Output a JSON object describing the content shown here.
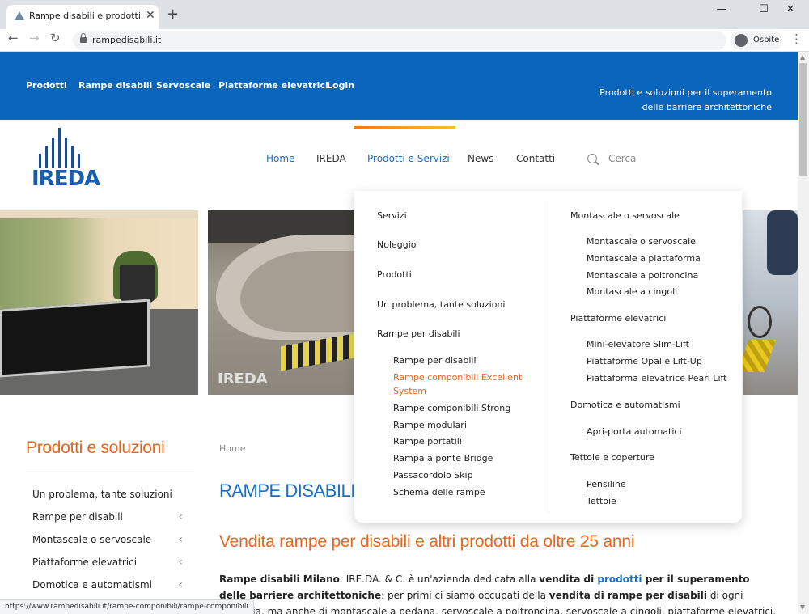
{
  "browser": {
    "tab_title": "Rampe disabili e prodotti per sup",
    "new_tab": "+",
    "close_tab": "✕",
    "url": "rampedisabili.it",
    "profile_label": "Ospite",
    "window_min": "—",
    "window_max": "☐",
    "window_close": "✕"
  },
  "topbar": {
    "links": [
      "Prodotti",
      "Rampe disabili",
      "Servoscale",
      "Piattaforme elevatrici",
      "Login"
    ],
    "tagline_line1": "Prodotti e soluzioni per il superamento",
    "tagline_line2": "delle barriere architettoniche"
  },
  "logo": {
    "text": "IREDA"
  },
  "mainnav": {
    "items": [
      "Home",
      "IREDA",
      "Prodotti e Servizi",
      "News",
      "Contatti"
    ],
    "search_placeholder": "Cerca",
    "colors": {
      "home": "#1a6fc4",
      "active": "#1a6fc4",
      "default": "#333333"
    }
  },
  "dropdown": {
    "left": [
      {
        "label": "Servizi"
      },
      {
        "label": "Noleggio"
      },
      {
        "label": "Prodotti"
      },
      {
        "label": "Un problema, tante soluzioni"
      },
      {
        "label": "Rampe per disabili"
      }
    ],
    "left_sub": [
      "Rampe per disabili",
      "Rampe componibili Excellent",
      "System",
      "Rampe componibili Strong",
      "Rampe modulari",
      "Rampe portatili",
      "Rampa a ponte Bridge",
      "Passacordolo Skip",
      "Schema delle rampe"
    ],
    "right_groups": [
      {
        "heading": "Montascale o servoscale",
        "items": [
          "Montascale o servoscale",
          "Montascale a piattaforma",
          "Montascale a poltroncina",
          "Montascale a cingoli"
        ]
      },
      {
        "heading": "Piattaforme elevatrici",
        "items": [
          "Mini-elevatore Slim-Lift",
          "Piattaforme Opal e Lift-Up",
          "Piattaforma elevatrice Pearl Lift"
        ]
      },
      {
        "heading": "Domotica e automatismi",
        "items": [
          "Apri-porta automatici"
        ]
      },
      {
        "heading": "Tettoie e coperture",
        "items": [
          "Pensiline",
          "Tettoie"
        ]
      }
    ],
    "highlight_color": "#e8661c"
  },
  "sidebar": {
    "title": "Prodotti e soluzioni",
    "items": [
      {
        "label": "Un problema, tante soluzioni"
      },
      {
        "label": "Rampe per disabili"
      },
      {
        "label": "Montascale o servoscale"
      },
      {
        "label": "Piattaforme elevatrici"
      },
      {
        "label": "Domotica e automatismi"
      }
    ]
  },
  "content": {
    "breadcrumb": "Home",
    "title": "RAMPE DISABILI MILANO",
    "subtitle": "Vendita rampe per disabili e altri prodotti da oltre 25 anni",
    "p1_bold1": "Rampe disabili Milano",
    "p1_t1": ": IRE.DA. & C. è un'azienda dedicata alla ",
    "p1_bold2": "vendita di ",
    "p1_link": "prodotti",
    "p1_bold3": " per il superamento delle barriere architettoniche",
    "p1_t2": ": per primi ci siamo occupati della ",
    "p1_bold4": "vendita di rampe per disabili",
    "p1_t3": " di ogni tipologia, ma anche di montascale a pedana, servoscale a poltroncina, servoscale a cingoli, piattaforme elevatrici,"
  },
  "statusbar": {
    "url": "https://www.rampedisabili.it/rampe-componibili/rampe-componibili"
  },
  "photo_overlay_text": "IREDA",
  "colors": {
    "brand_blue": "#0a66bd",
    "accent_orange": "#e8661c",
    "title_blue": "#1a6fc4"
  }
}
